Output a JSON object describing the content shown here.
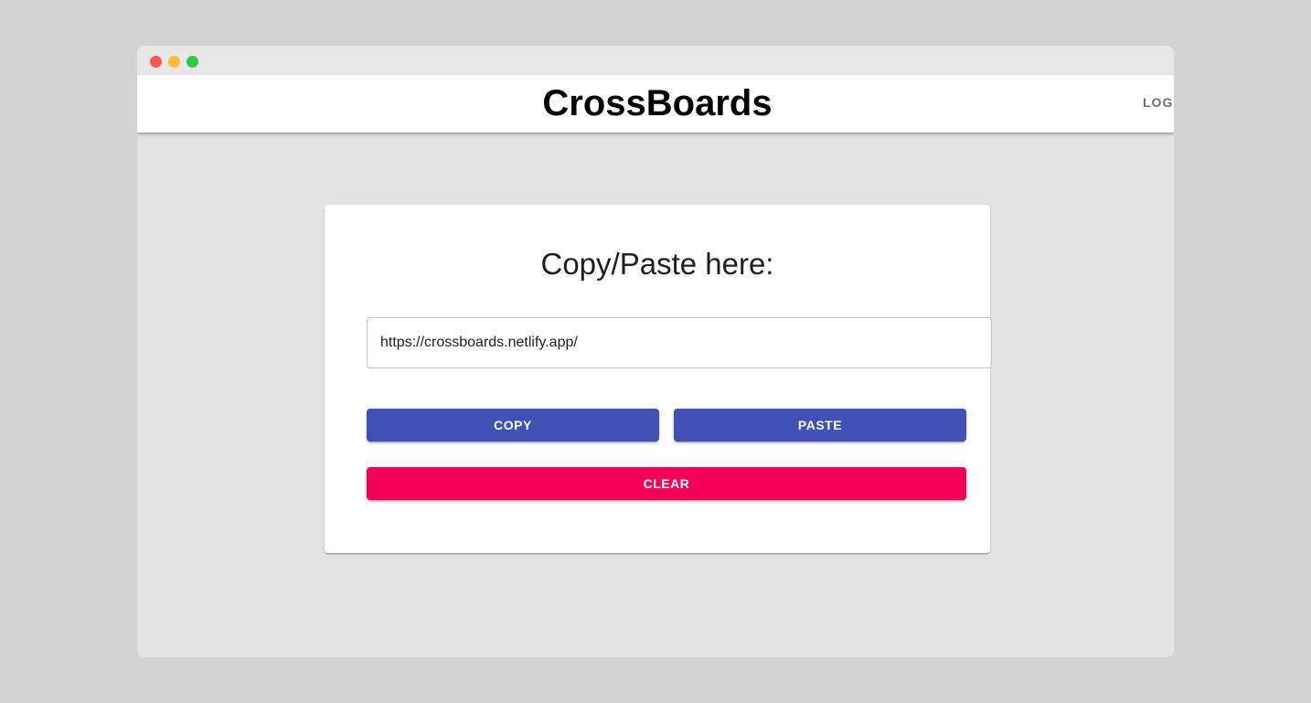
{
  "window": {
    "controls": [
      "close",
      "minimize",
      "maximize"
    ]
  },
  "appbar": {
    "title": "CrossBoards",
    "logout_label": "LOGOUT"
  },
  "card": {
    "heading": "Copy/Paste here:",
    "input_value": "https://crossboards.netlify.app/",
    "copy_label": "COPY",
    "paste_label": "PASTE",
    "clear_label": "CLEAR"
  },
  "colors": {
    "primary": "#3f51b5",
    "secondary": "#f50057",
    "background": "#e3e3e3",
    "appbar": "#ffffff"
  }
}
